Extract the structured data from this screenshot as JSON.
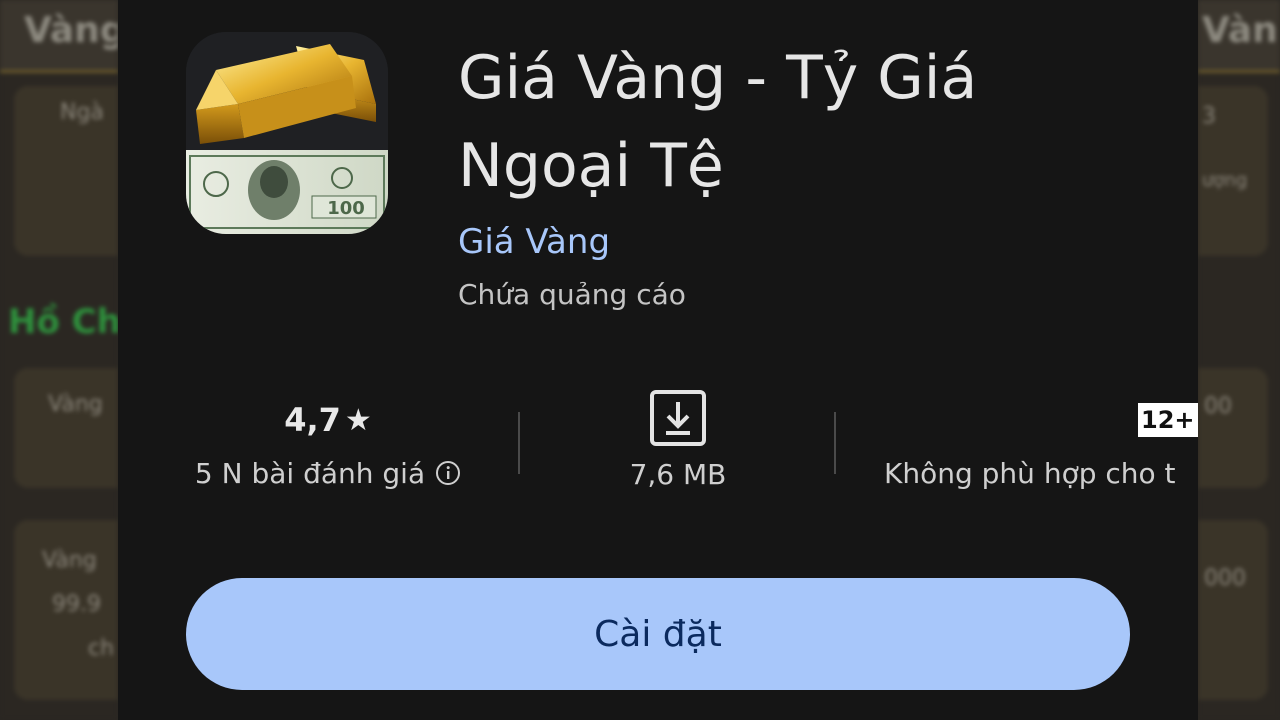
{
  "app": {
    "title": "Giá Vàng - Tỷ Giá Ngoại Tệ",
    "developer": "Giá Vàng",
    "ads_notice": "Chứa quảng cáo"
  },
  "stats": {
    "rating": {
      "value": "4,7",
      "star": "★",
      "label": "5 N bài đánh giá",
      "info_icon": "info-icon"
    },
    "size": {
      "icon": "download-icon",
      "label": "7,6 MB"
    },
    "age": {
      "badge": "12+",
      "label": "Không phù hợp cho t"
    }
  },
  "install_button": {
    "label": "Cài đặt"
  },
  "icon_image": {
    "banknote_denomination": "100"
  },
  "colors": {
    "panel_bg": "#151515",
    "accent": "#a8c7fa",
    "button_text": "#0b2a5e",
    "gold": "#d9a520"
  },
  "background_app": {
    "header": "Vàng",
    "left_texts": [
      "Ngà",
      "Vàng",
      "Vàng",
      "99.9",
      "ch"
    ],
    "left_heading": "Hồ Ch",
    "right_header": "Vàn",
    "right_texts": [
      "3",
      "ượng",
      "00",
      "000"
    ]
  }
}
